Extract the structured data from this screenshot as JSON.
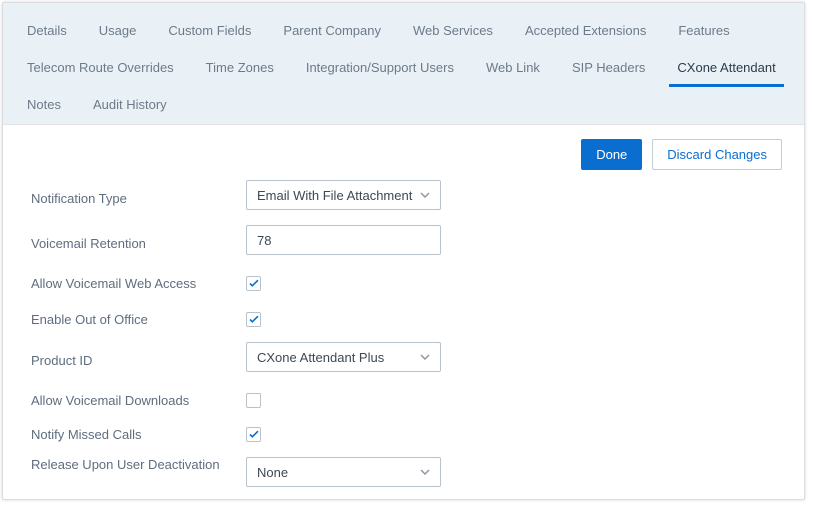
{
  "tabs": {
    "row1": [
      {
        "label": "Details"
      },
      {
        "label": "Usage"
      },
      {
        "label": "Custom Fields"
      },
      {
        "label": "Parent Company"
      },
      {
        "label": "Web Services"
      },
      {
        "label": "Accepted Extensions"
      },
      {
        "label": "Features"
      }
    ],
    "row2": [
      {
        "label": "Telecom Route Overrides"
      },
      {
        "label": "Time Zones"
      },
      {
        "label": "Integration/Support Users"
      },
      {
        "label": "Web Link"
      },
      {
        "label": "SIP Headers"
      },
      {
        "label": "CXone Attendant",
        "active": true
      }
    ],
    "row3": [
      {
        "label": "Notes"
      },
      {
        "label": "Audit History"
      }
    ]
  },
  "actions": {
    "done": "Done",
    "discard": "Discard Changes"
  },
  "form": {
    "notification_type": {
      "label": "Notification Type",
      "value": "Email With File Attachment"
    },
    "voicemail_retention": {
      "label": "Voicemail Retention",
      "value": "78"
    },
    "allow_web_access": {
      "label": "Allow Voicemail Web Access",
      "checked": true
    },
    "enable_ooo": {
      "label": "Enable Out of Office",
      "checked": true
    },
    "product_id": {
      "label": "Product ID",
      "value": "CXone Attendant Plus"
    },
    "allow_downloads": {
      "label": "Allow Voicemail Downloads",
      "checked": false
    },
    "notify_missed": {
      "label": "Notify Missed Calls",
      "checked": true
    },
    "release_upon": {
      "label": "Release Upon User Deactivation",
      "value": "None"
    }
  }
}
